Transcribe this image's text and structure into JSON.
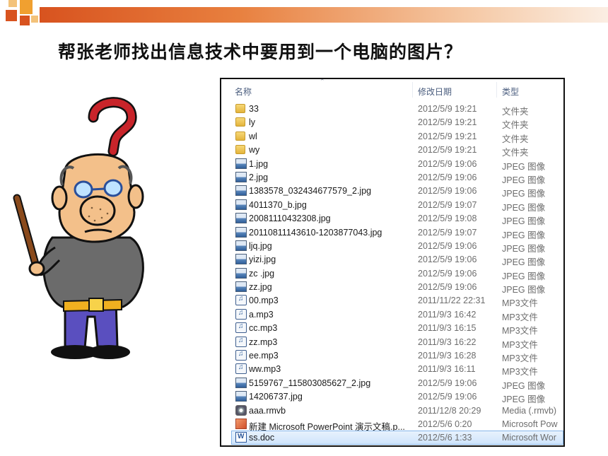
{
  "title": "帮张老师找出信息技术中要用到一个电脑的图片？",
  "explorer": {
    "columns": {
      "name": "名称",
      "date": "修改日期",
      "type": "类型"
    },
    "files": [
      {
        "name": "33",
        "date": "2012/5/9 19:21",
        "type": "文件夹",
        "icon": "folder-icon"
      },
      {
        "name": "ly",
        "date": "2012/5/9 19:21",
        "type": "文件夹",
        "icon": "folder-icon"
      },
      {
        "name": "wl",
        "date": "2012/5/9 19:21",
        "type": "文件夹",
        "icon": "folder-icon"
      },
      {
        "name": "wy",
        "date": "2012/5/9 19:21",
        "type": "文件夹",
        "icon": "folder-icon"
      },
      {
        "name": "1.jpg",
        "date": "2012/5/9 19:06",
        "type": "JPEG 图像",
        "icon": "jpeg-icon"
      },
      {
        "name": "2.jpg",
        "date": "2012/5/9 19:06",
        "type": "JPEG 图像",
        "icon": "jpeg-icon"
      },
      {
        "name": "1383578_032434677579_2.jpg",
        "date": "2012/5/9 19:06",
        "type": "JPEG 图像",
        "icon": "jpeg-icon"
      },
      {
        "name": "4011370_b.jpg",
        "date": "2012/5/9 19:07",
        "type": "JPEG 图像",
        "icon": "jpeg-icon"
      },
      {
        "name": "20081110432308.jpg",
        "date": "2012/5/9 19:08",
        "type": "JPEG 图像",
        "icon": "jpeg-icon"
      },
      {
        "name": "20110811143610-1203877043.jpg",
        "date": "2012/5/9 19:07",
        "type": "JPEG 图像",
        "icon": "jpeg-icon"
      },
      {
        "name": "ljq.jpg",
        "date": "2012/5/9 19:06",
        "type": "JPEG 图像",
        "icon": "jpeg-icon"
      },
      {
        "name": "yizi.jpg",
        "date": "2012/5/9 19:06",
        "type": "JPEG 图像",
        "icon": "jpeg-icon"
      },
      {
        "name": "zc .jpg",
        "date": "2012/5/9 19:06",
        "type": "JPEG 图像",
        "icon": "jpeg-icon"
      },
      {
        "name": "zz.jpg",
        "date": "2012/5/9 19:06",
        "type": "JPEG 图像",
        "icon": "jpeg-icon"
      },
      {
        "name": "00.mp3",
        "date": "2011/11/22 22:31",
        "type": "MP3文件",
        "icon": "mp3-icon"
      },
      {
        "name": "a.mp3",
        "date": "2011/9/3 16:42",
        "type": "MP3文件",
        "icon": "mp3-icon"
      },
      {
        "name": "cc.mp3",
        "date": "2011/9/3 16:15",
        "type": "MP3文件",
        "icon": "mp3-icon"
      },
      {
        "name": "zz.mp3",
        "date": "2011/9/3 16:22",
        "type": "MP3文件",
        "icon": "mp3-icon"
      },
      {
        "name": "ee.mp3",
        "date": "2011/9/3 16:28",
        "type": "MP3文件",
        "icon": "mp3-icon"
      },
      {
        "name": "ww.mp3",
        "date": "2011/9/3 16:11",
        "type": "MP3文件",
        "icon": "mp3-icon"
      },
      {
        "name": "5159767_115803085627_2.jpg",
        "date": "2012/5/9 19:06",
        "type": "JPEG 图像",
        "icon": "jpeg-icon"
      },
      {
        "name": "14206737.jpg",
        "date": "2012/5/9 19:06",
        "type": "JPEG 图像",
        "icon": "jpeg-icon"
      },
      {
        "name": "aaa.rmvb",
        "date": "2011/12/8 20:29",
        "type": "Media (.rmvb)",
        "icon": "media-icon"
      },
      {
        "name": "新建 Microsoft PowerPoint 演示文稿.p...",
        "date": "2012/5/6 0:20",
        "type": "Microsoft Pow",
        "icon": "powerpoint-icon"
      },
      {
        "name": "ss.doc",
        "date": "2012/5/6 1:33",
        "type": "Microsoft Wor",
        "icon": "word-icon",
        "selected": true
      }
    ]
  },
  "colors": {
    "banner_dark": "#d8531f",
    "banner_light": "#f5c8a4",
    "selection": "#cfe4fb"
  }
}
